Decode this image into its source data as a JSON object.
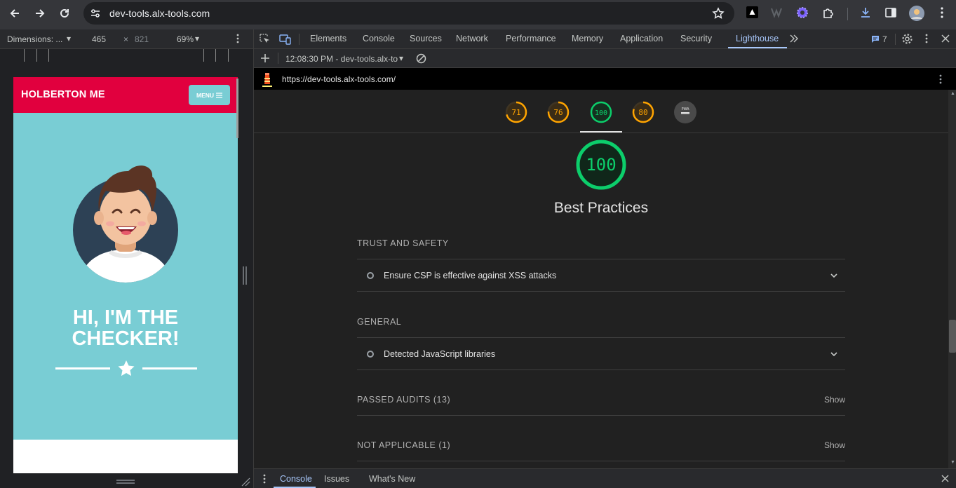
{
  "browser": {
    "url": "dev-tools.alx-tools.com",
    "extensions": [
      "dark-reader-icon",
      "wappalyzer-icon",
      "gear-flower-icon",
      "puzzle-icon"
    ]
  },
  "device_toolbar": {
    "dimensions_label": "Dimensions: ...",
    "width": "465",
    "times": "×",
    "height": "821",
    "zoom": "69%"
  },
  "page_preview": {
    "logo": "HOLBERTON ME",
    "menu_label": "MENU",
    "hero_line1": "HI, I'M THE",
    "hero_line2": "CHECKER!"
  },
  "devtools": {
    "tabs": [
      "Elements",
      "Console",
      "Sources",
      "Network",
      "Performance",
      "Memory",
      "Application",
      "Security",
      "Lighthouse"
    ],
    "active_tab": "Lighthouse",
    "issues_count": "7",
    "report_selector": "12:08:30 PM - dev-tools.alx-to",
    "report_url": "https://dev-tools.alx-tools.com/",
    "drawer_tabs": [
      "Console",
      "Issues",
      "What's New"
    ]
  },
  "lighthouse": {
    "gauges": [
      {
        "score": "71",
        "color": "#ffa400"
      },
      {
        "score": "76",
        "color": "#ffa400"
      },
      {
        "score": "100",
        "color": "#0cce6b"
      },
      {
        "score": "80",
        "color": "#ffa400"
      },
      {
        "score": "PWA",
        "color": "#9aa0a6"
      }
    ],
    "active_score": "100",
    "category_title": "Best Practices",
    "groups": [
      {
        "title": "TRUST AND SAFETY",
        "audit": "Ensure CSP is effective against XSS attacks"
      },
      {
        "title": "GENERAL",
        "audit": "Detected JavaScript libraries"
      }
    ],
    "passed": {
      "label": "PASSED AUDITS (13)",
      "action": "Show"
    },
    "not_applicable": {
      "label": "NOT APPLICABLE (1)",
      "action": "Show"
    }
  }
}
